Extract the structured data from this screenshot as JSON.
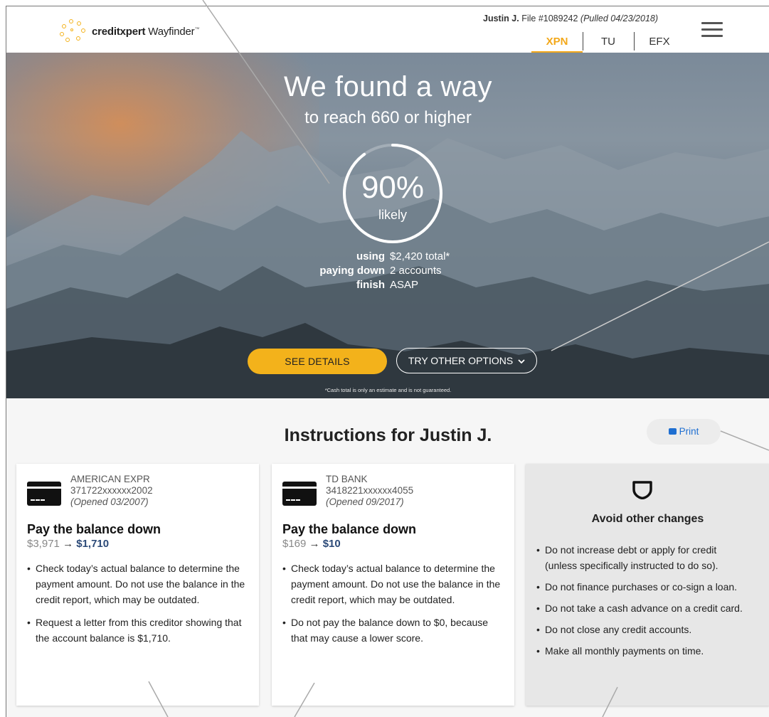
{
  "header": {
    "brand_name": "creditxpert",
    "product_name": "Wayfinder",
    "trademark": "™",
    "user_name": "Justin J.",
    "file_number": "File #1089242",
    "pulled_date": "(Pulled 04/23/2018)",
    "bureau_tabs": [
      "XPN",
      "TU",
      "EFX"
    ],
    "active_tab": "XPN"
  },
  "hero": {
    "title": "We found a way",
    "subtitle": "to reach 660 or higher",
    "likelihood_percent": "90%",
    "likelihood_value": 0.9,
    "likelihood_label": "likely",
    "stats": [
      {
        "key": "using",
        "value": "$2,420 total*"
      },
      {
        "key": "paying down",
        "value": "2 accounts"
      },
      {
        "key": "finish",
        "value": "ASAP"
      }
    ],
    "see_details_label": "SEE DETAILS",
    "try_other_label": "TRY OTHER OPTIONS",
    "disclaimer": "*Cash total is only an estimate and is not guaranteed."
  },
  "instructions": {
    "title": "Instructions for Justin J.",
    "print_label": "Print",
    "cards": [
      {
        "creditor": "AMERICAN EXPR",
        "account": "371722xxxxxx2002",
        "opened": "(Opened 03/2007)",
        "action": "Pay the balance down",
        "from_amount": "$3,971",
        "arrow": "→",
        "to_amount": "$1,710",
        "bullets": [
          "Check today’s actual balance to determine the payment amount. Do not use the balance in the credit report, which may be outdated.",
          "Request a letter from this creditor showing that the account balance is $1,710."
        ]
      },
      {
        "creditor": "TD BANK",
        "account": "3418221xxxxxx4055",
        "opened": "(Opened 09/2017)",
        "action": "Pay the balance down",
        "from_amount": "$169",
        "arrow": "→",
        "to_amount": "$10",
        "bullets": [
          "Check today’s actual balance to determine the payment amount. Do not use the balance in the credit report, which may be outdated.",
          "Do not pay the balance down to $0, because that may cause a lower score."
        ]
      }
    ],
    "avoid": {
      "title": "Avoid other changes",
      "bullets": [
        "Do not increase debt or apply for credit (unless specifically instructed to do so).",
        "Do not finance purchases or co-sign a loan.",
        "Do not take a cash advance on a credit card.",
        "Do not close any credit accounts.",
        "Make all monthly payments on time."
      ]
    }
  },
  "colors": {
    "accent": "#f3b21b",
    "link": "#1f6fd1",
    "amount_highlight": "#2c4a78"
  },
  "icons": [
    "logo-sunburst-icon",
    "menu-icon",
    "chevron-down-icon",
    "print-icon",
    "credit-card-icon",
    "shield-icon"
  ]
}
